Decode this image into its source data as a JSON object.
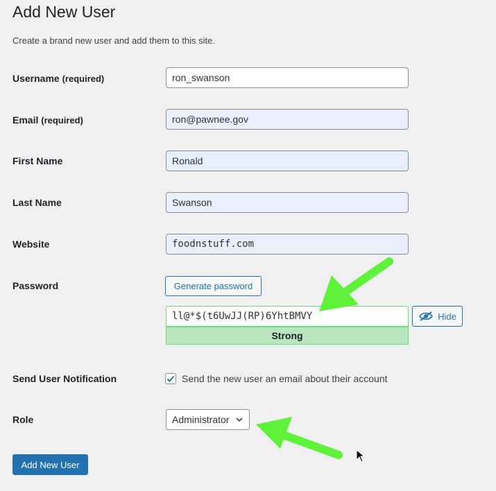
{
  "page": {
    "title": "Add New User",
    "description": "Create a brand new user and add them to this site."
  },
  "fields": {
    "username": {
      "label": "Username",
      "required_note": "(required)",
      "value": "ron_swanson"
    },
    "email": {
      "label": "Email",
      "required_note": "(required)",
      "value": "ron@pawnee.gov"
    },
    "first_name": {
      "label": "First Name",
      "value": "Ronald"
    },
    "last_name": {
      "label": "Last Name",
      "value": "Swanson"
    },
    "website": {
      "label": "Website",
      "value": "foodnstuff.com"
    }
  },
  "password": {
    "label": "Password",
    "generate_label": "Generate password",
    "value": "ll@*$(t6UwJJ(RP)6YhtBMVY",
    "hide_label": "Hide",
    "strength_label": "Strong"
  },
  "notification": {
    "label": "Send User Notification",
    "checkbox_label": "Send the new user an email about their account",
    "checked": true
  },
  "role": {
    "label": "Role",
    "selected": "Administrator"
  },
  "submit_label": "Add New User",
  "colors": {
    "primary": "#2271b1",
    "background": "#f0f0f1",
    "strength_strong": "#b8e6bf",
    "annotation_arrow": "#5ef23a"
  },
  "icons": [
    "eye-slash-icon",
    "chevron-down-icon",
    "checkmark-icon",
    "mouse-cursor-icon",
    "arrow-annotation"
  ]
}
